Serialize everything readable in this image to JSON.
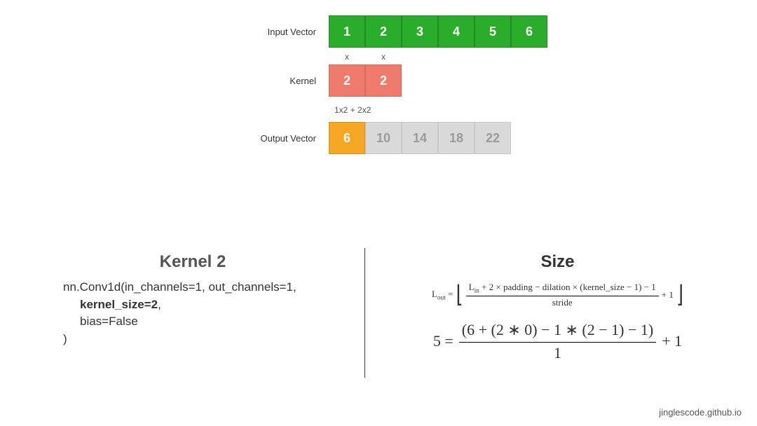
{
  "diagram": {
    "input": {
      "label": "Input Vector",
      "values": [
        "1",
        "2",
        "3",
        "4",
        "5",
        "6"
      ]
    },
    "mult_markers": [
      "x",
      "x"
    ],
    "kernel": {
      "label": "Kernel",
      "values": [
        "2",
        "2"
      ]
    },
    "calc_text": "1x2 + 2x2",
    "output": {
      "label": "Output Vector",
      "active": "6",
      "rest": [
        "10",
        "14",
        "18",
        "22"
      ]
    }
  },
  "left": {
    "title": "Kernel 2",
    "code_line1": "nn.Conv1d(in_channels=1, out_channels=1,",
    "code_line2": "kernel_size=2",
    "code_line2_suffix": ",",
    "code_line3": "bias=False",
    "code_line4": ")"
  },
  "right": {
    "title": "Size",
    "formula": {
      "lhs_prefix": "L",
      "lhs_sub": "out",
      "eq": " = ",
      "num_prefix": "L",
      "num_sub": "in",
      "num_rest": " + 2 × padding − dilation × (kernel_size − 1) − 1",
      "den": "stride",
      "tail": " + 1"
    },
    "calc": {
      "lhs": "5 = ",
      "num": "(6 + (2 ∗ 0) − 1 ∗ (2 − 1) − 1)",
      "den": "1",
      "tail": " + 1"
    }
  },
  "footer": "jinglescode.github.io"
}
